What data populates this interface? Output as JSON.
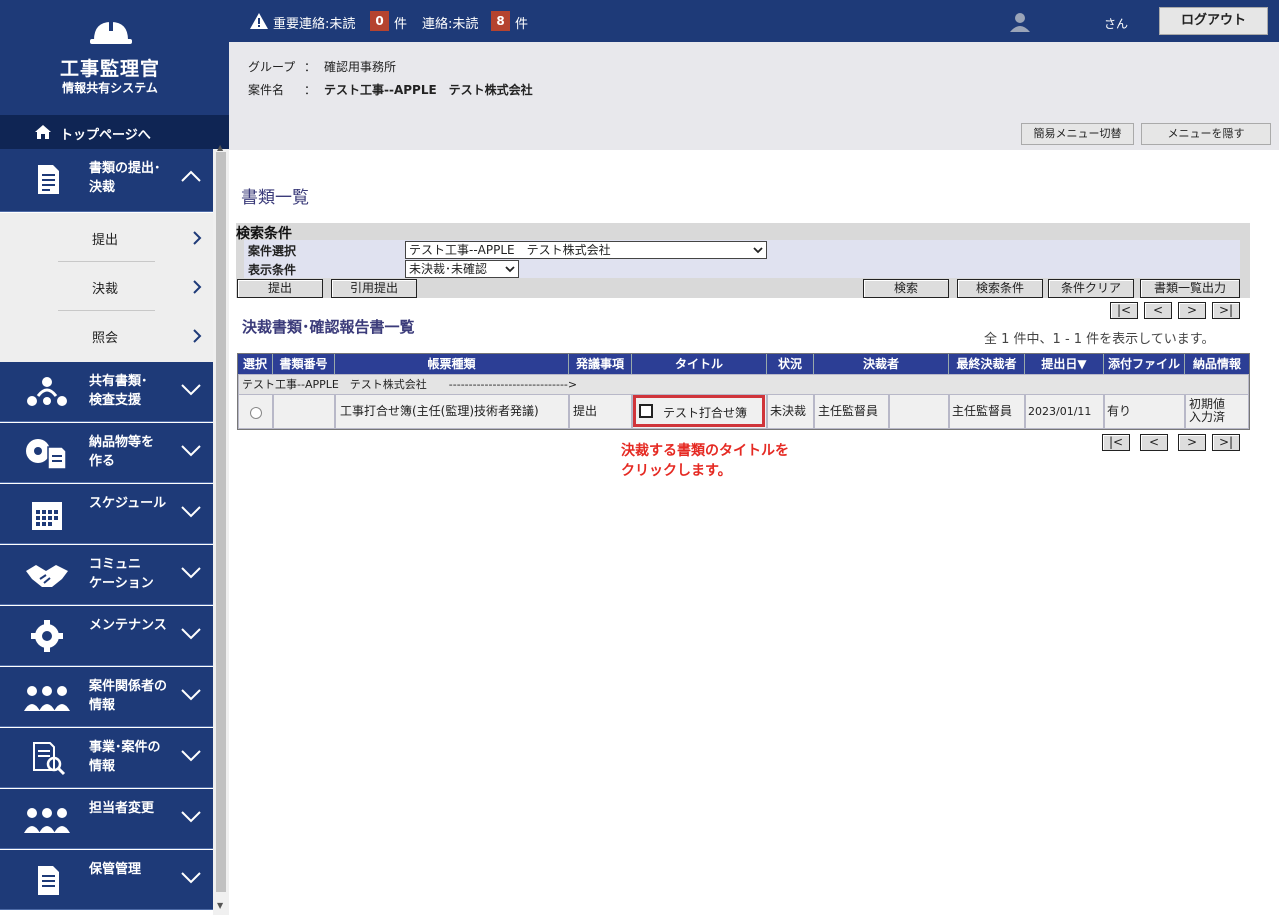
{
  "header": {
    "important_label": "重要連絡:未読",
    "important_count": "0",
    "important_unit": "件",
    "contact_label": "連絡:未読",
    "contact_count": "8",
    "contact_unit": "件",
    "user_suffix": "さん",
    "logout_label": "ログアウト"
  },
  "logo": {
    "title": "工事監理官",
    "subtitle": "情報共有システム"
  },
  "sidebar": {
    "top_page": "トップページへ",
    "menu": [
      {
        "label": "書類の提出･\n決裁",
        "icon": "document-icon",
        "expanded": true
      },
      {
        "label": "共有書類･\n検査支援",
        "icon": "team-share-icon"
      },
      {
        "label": "納品物等を\n作る",
        "icon": "disc-document-icon"
      },
      {
        "label": "スケジュール",
        "icon": "calendar-icon"
      },
      {
        "label": "コミュニ\nケーション",
        "icon": "handshake-icon"
      },
      {
        "label": "メンテナンス",
        "icon": "gear-icon"
      },
      {
        "label": "案件関係者の\n情報",
        "icon": "people-icon"
      },
      {
        "label": "事業･案件の\n情報",
        "icon": "document-search-icon"
      },
      {
        "label": "担当者変更",
        "icon": "people-icon"
      },
      {
        "label": "保管管理",
        "icon": "document-icon"
      }
    ],
    "submenu": [
      "提出",
      "決裁",
      "照会"
    ]
  },
  "info": {
    "group_key": "グループ",
    "group_val": "確認用事務所",
    "case_key": "案件名",
    "case_val": "テスト工事--APPLE　テスト株式会社",
    "colon": "：",
    "simple_menu_btn": "簡易メニュー切替",
    "hide_menu_btn": "メニューを隠す"
  },
  "page": {
    "title": "書類一覧"
  },
  "search": {
    "header": "検索条件",
    "case_select_label": "案件選択",
    "case_select_value": "テスト工事--APPLE　テスト株式会社",
    "display_label": "表示条件",
    "display_value": "未決裁･未確認",
    "buttons": {
      "submit": "提出",
      "cite_submit": "引用提出",
      "search": "検索",
      "search_conditions": "検索条件",
      "clear": "条件クリア",
      "export": "書類一覧出力"
    }
  },
  "pager": {
    "first": "|<",
    "prev": "<",
    "next": ">",
    "last": ">|"
  },
  "list": {
    "title": "決裁書類･確認報告書一覧",
    "count_info": "全 1 件中、1 - 1 件を表示しています。",
    "columns": [
      "選択",
      "書類番号",
      "帳票種類",
      "発議事項",
      "タイトル",
      "状況",
      "決裁者",
      "最終決裁者",
      "提出日▼",
      "添付ファイル",
      "納品情報"
    ],
    "group_row": "テスト工事--APPLE　テスト株式会社　　------------------------------>",
    "row": {
      "doc_no": "",
      "form_type": "工事打合せ簿(主任(監理)技術者発議)",
      "issue": "提出",
      "title": "テスト打合せ簿",
      "status": "未決裁",
      "approver": "主任監督員",
      "final_approver": "",
      "final_approver2": "主任監督員",
      "date": "2023/01/11",
      "attachment": "有り",
      "delivery": "初期値\n入力済"
    }
  },
  "annotation": "決裁する書類のタイトルを\nクリックします。",
  "colors": {
    "navy": "#1e3a78",
    "table_header": "#2c3e95",
    "annotation": "#e52a23"
  }
}
